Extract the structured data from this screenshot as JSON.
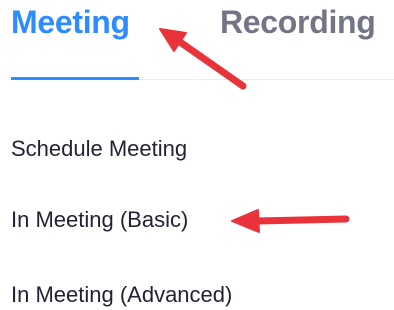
{
  "tabs": [
    {
      "label": "Meeting",
      "active": true
    },
    {
      "label": "Recording",
      "active": false
    }
  ],
  "menu": {
    "items": [
      {
        "label": "Schedule Meeting"
      },
      {
        "label": "In Meeting (Basic)"
      },
      {
        "label": "In Meeting (Advanced)"
      }
    ]
  },
  "colors": {
    "active_tab": "#2d8cff",
    "inactive_tab": "#747487",
    "menu_text": "#232333",
    "annotation_arrow": "#e8333b"
  },
  "annotations": {
    "arrows": [
      {
        "icon": "red-arrow-icon",
        "points_to": "Meeting"
      },
      {
        "icon": "red-arrow-icon",
        "points_to": "In Meeting (Basic)"
      }
    ]
  }
}
